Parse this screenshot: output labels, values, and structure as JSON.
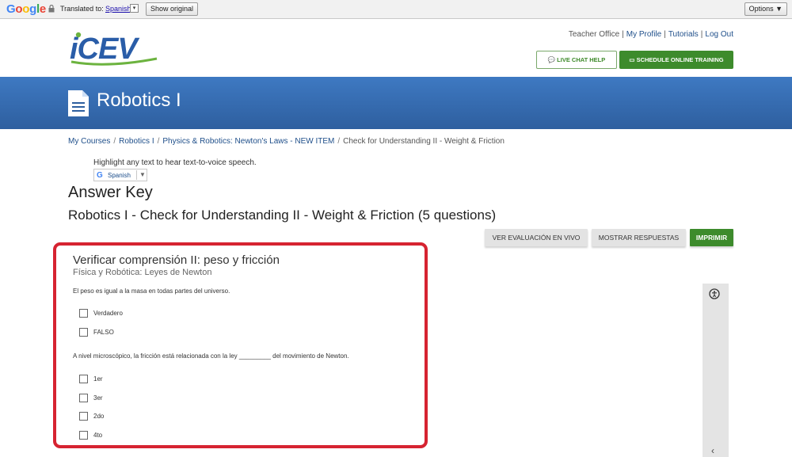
{
  "translate_bar": {
    "brand": "Google",
    "translated_to": "Translated to:",
    "language": "Spanish",
    "caret": "▾",
    "show_original": "Show original",
    "options": "Options ▼"
  },
  "header": {
    "logo_text": "iCEV",
    "links": [
      "Teacher Office",
      "My Profile",
      "Tutorials",
      "Log Out"
    ],
    "live_chat": "LIVE CHAT HELP",
    "schedule": "SCHEDULE ONLINE TRAINING"
  },
  "banner": {
    "course_title": "Robotics I"
  },
  "breadcrumb": [
    "My Courses",
    "Robotics I",
    "Physics & Robotics: Newton's Laws - NEW ITEM",
    "Check for Understanding II - Weight & Friction"
  ],
  "tts": {
    "instruction": "Highlight any text to hear text-to-voice speech.",
    "language": "Spanish",
    "g": "G",
    "caret": "▼"
  },
  "page": {
    "answer_key": "Answer Key",
    "heading": "Robotics I - Check for Understanding II - Weight & Friction (5 questions)"
  },
  "actions": {
    "live": "VER EVALUACIÓN EN VIVO",
    "show": "MOSTRAR RESPUESTAS",
    "print": "IMPRIMIR"
  },
  "quiz": {
    "title": "Verificar comprensión II: peso y fricción",
    "subtitle": "Física y Robótica: Leyes de Newton",
    "questions": [
      {
        "text": "El peso es igual a la masa en todas partes del universo.",
        "options": [
          "Verdadero",
          "FALSO"
        ]
      },
      {
        "text": "A nivel microscópico, la fricción está relacionada con la ley _________ del movimiento de Newton.",
        "options": [
          "1er",
          "3er",
          "2do",
          "4to"
        ]
      }
    ]
  },
  "side_panel": {
    "chevron": "‹"
  },
  "colors": {
    "accent_blue": "#2e5f9f",
    "green": "#3d8b2c",
    "highlight_red": "#d62331"
  }
}
